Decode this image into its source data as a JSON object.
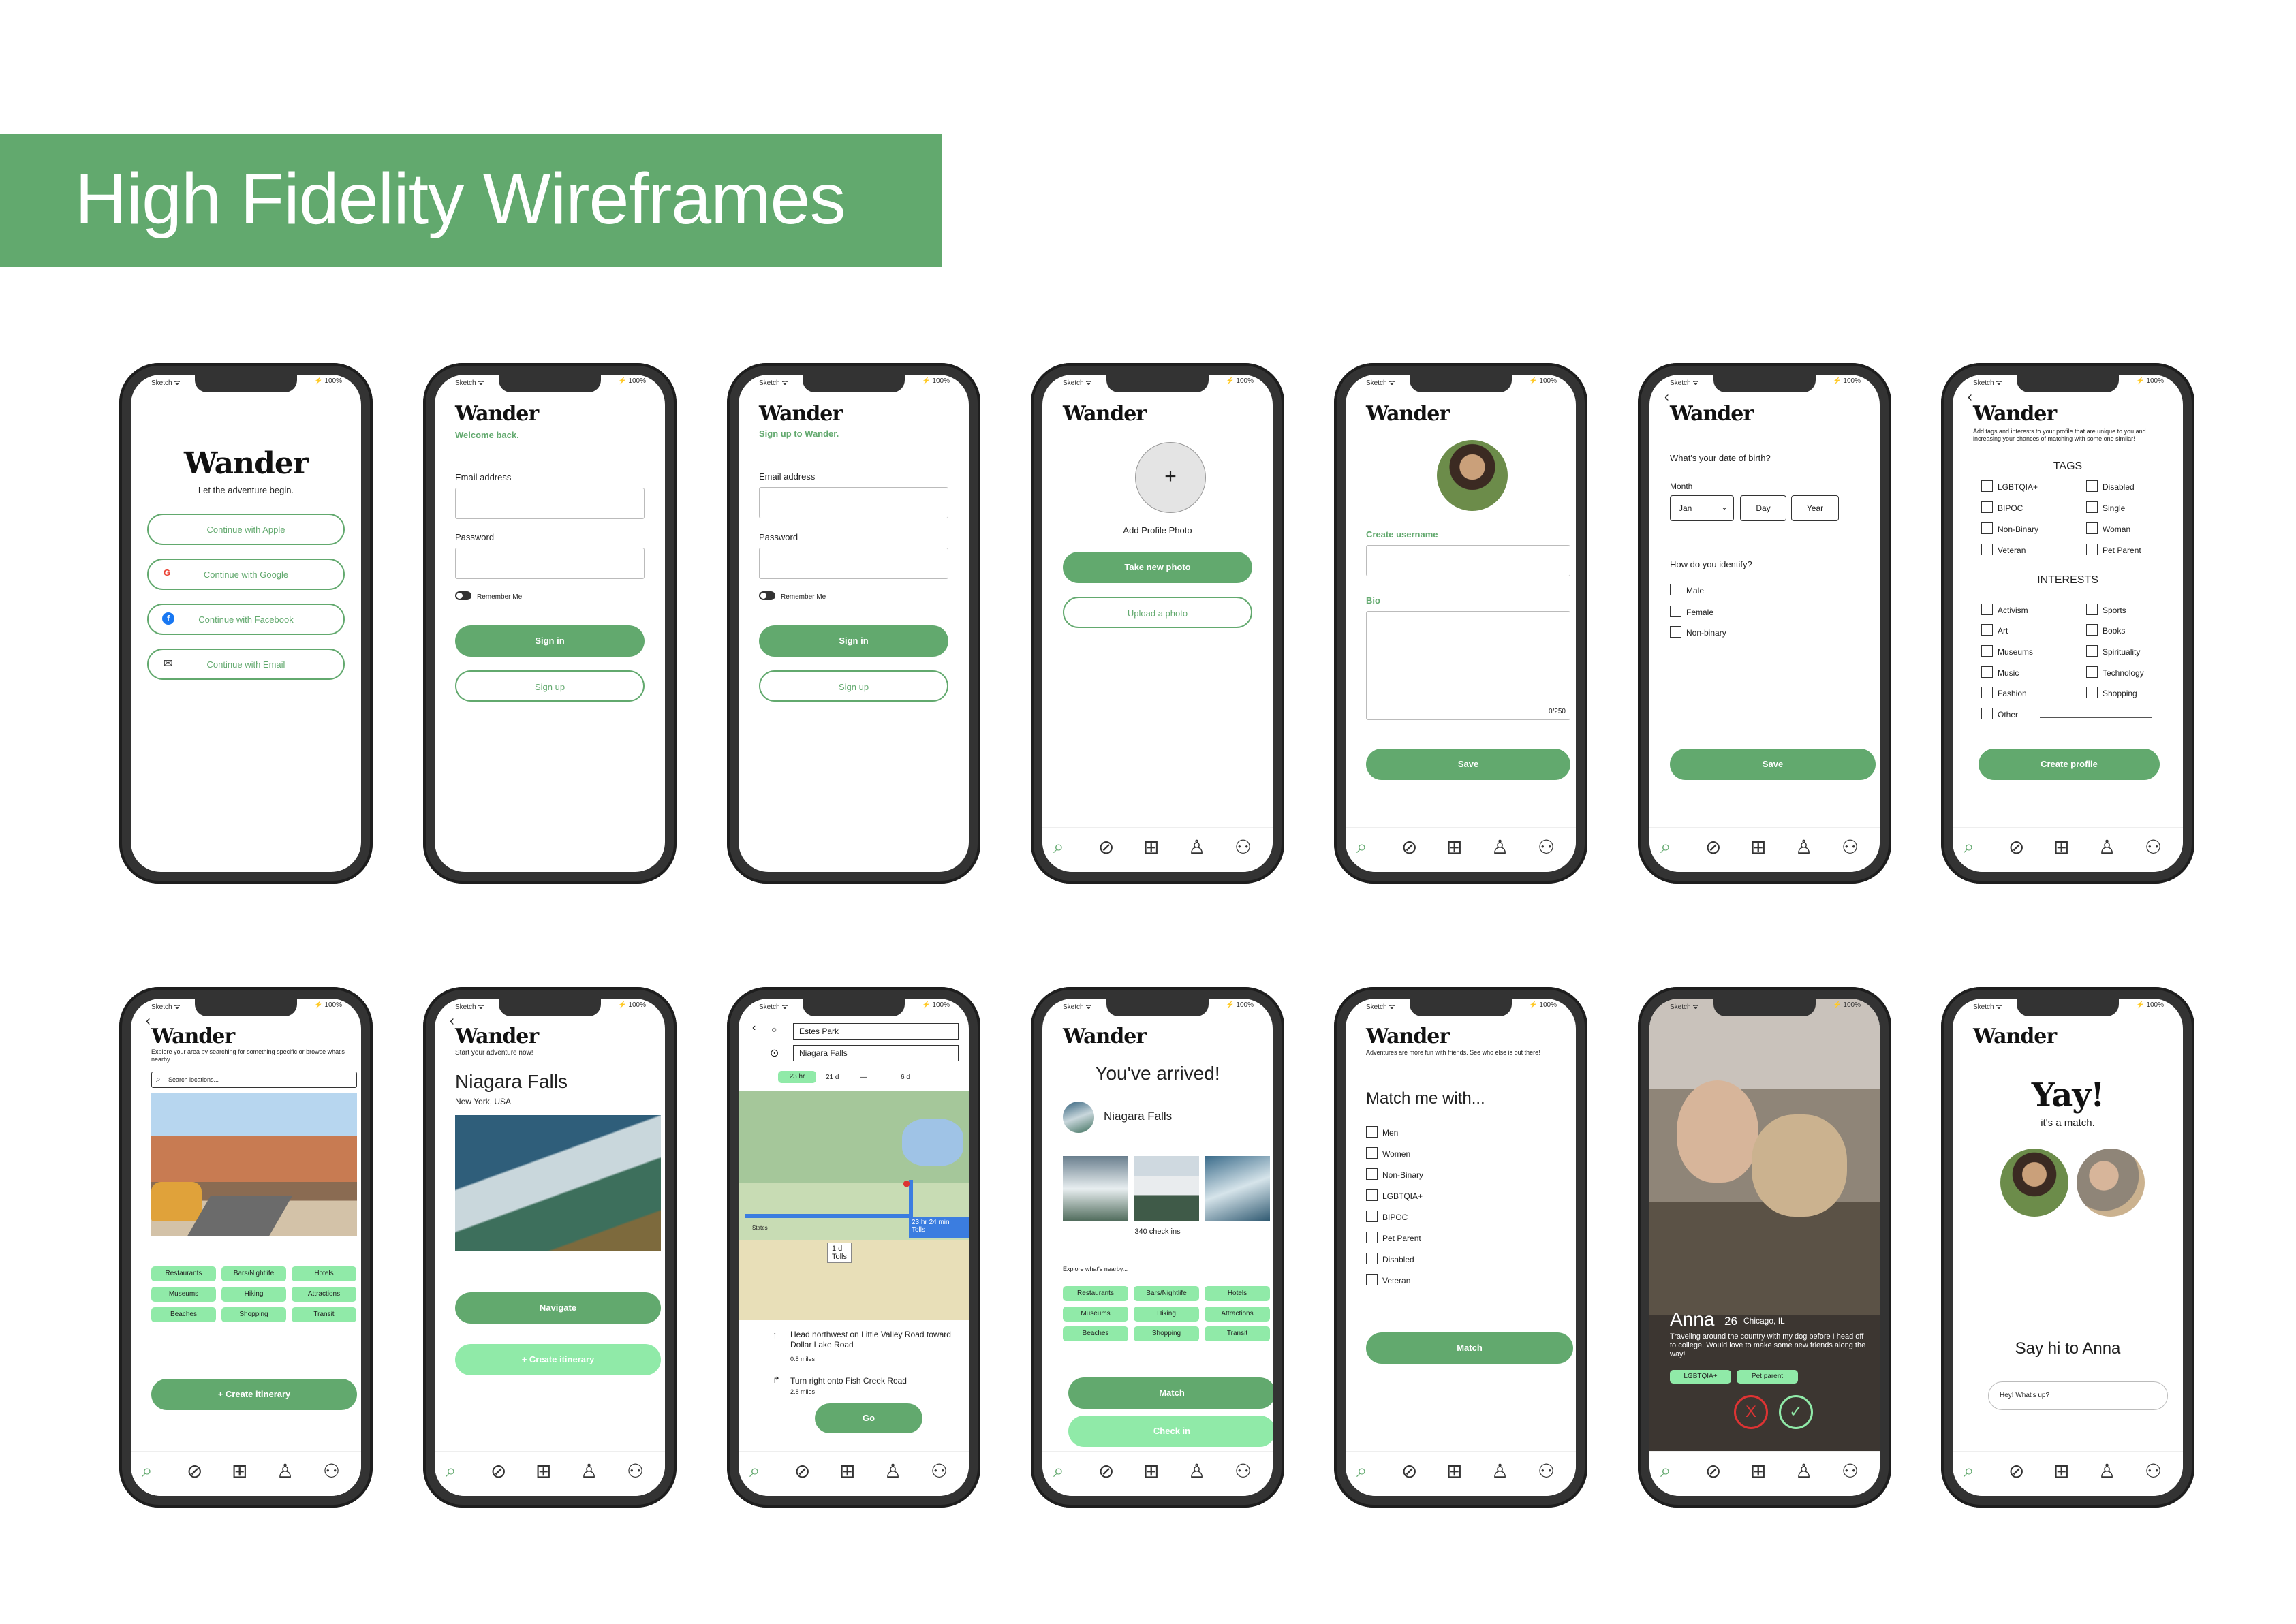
{
  "banner": {
    "title": "High Fidelity Wireframes"
  },
  "status": {
    "left": "Sketch ᯤ",
    "right": "⚡ 100%"
  },
  "brand": "Wander",
  "nav_icons": [
    "search-icon",
    "compass-icon",
    "add-file-icon",
    "user-icon",
    "match-users-icon"
  ],
  "s1": {
    "tagline": "Let the adventure begin.",
    "apple": "Continue with Apple",
    "google": "Continue with Google",
    "facebook": "Continue with Facebook",
    "email": "Continue with Email"
  },
  "s2": {
    "subtitle": "Welcome back.",
    "email_label": "Email address",
    "password_label": "Password",
    "remember": "Remember Me",
    "primary": "Sign in",
    "secondary": "Sign up"
  },
  "s3": {
    "subtitle": "Sign up to Wander.",
    "email_label": "Email address",
    "password_label": "Password",
    "remember": "Remember Me",
    "primary": "Sign in",
    "secondary": "Sign up"
  },
  "s4": {
    "plus": "+",
    "add_photo": "Add Profile Photo",
    "take": "Take new photo",
    "upload": "Upload a photo"
  },
  "s5": {
    "username_label": "Create username",
    "bio_label": "Bio",
    "counter": "0/250",
    "save": "Save"
  },
  "s6": {
    "back": "‹",
    "dob_q": "What's your date of birth?",
    "month_label": "Month",
    "month": "Jan",
    "day": "Day",
    "year": "Year",
    "identify_q": "How do you identify?",
    "opts": [
      "Male",
      "Female",
      "Non-binary"
    ],
    "save": "Save"
  },
  "s7": {
    "back": "‹",
    "intro": "Add tags and interests to your profile that are unique to you and increasing your chances of matching with some one similar!",
    "tags_h": "TAGS",
    "tags_l": [
      "LGBTQIA+",
      "BIPOC",
      "Non-Binary",
      "Veteran"
    ],
    "tags_r": [
      "Disabled",
      "Single",
      "Woman",
      "Pet Parent"
    ],
    "int_h": "INTERESTS",
    "int_l": [
      "Activism",
      "Art",
      "Museums",
      "Music",
      "Fashion",
      "Other"
    ],
    "int_r": [
      "Sports",
      "Books",
      "Spirituality",
      "Technology",
      "Shopping"
    ],
    "create": "Create profile"
  },
  "s8": {
    "back": "‹",
    "intro": "Explore your area by searching for something specific or browse what's nearby.",
    "search": "Search locations...",
    "chips": [
      "Restaurants",
      "Bars/Nightlife",
      "Hotels",
      "Museums",
      "Hiking",
      "Attractions",
      "Beaches",
      "Shopping",
      "Transit"
    ],
    "create": "+ Create itinerary"
  },
  "s9": {
    "back": "‹",
    "subtitle": "Start your adventure now!",
    "place": "Niagara Falls",
    "location": "New York, USA",
    "navigate": "Navigate",
    "itinerary": "+ Create itinerary"
  },
  "s10": {
    "back": "‹",
    "from": "Estes Park",
    "to": "Niagara Falls",
    "modes": [
      "23 hr",
      "21 d",
      "—",
      "6 d"
    ],
    "route_time": "23 hr 24 min",
    "tolls": "Tolls",
    "states": "States",
    "alt_time": "1 d",
    "alt_tolls": "Tolls",
    "step1": "Head northwest on Little Valley Road toward Dollar Lake Road",
    "dist1": "0.8 miles",
    "step2": "Turn right onto Fish Creek Road",
    "dist2": "2.8 miles",
    "go": "Go"
  },
  "s11": {
    "arrived": "You've arrived!",
    "place": "Niagara Falls",
    "checkins": "340 check ins",
    "explore": "Explore what's nearby...",
    "chips": [
      "Restaurants",
      "Bars/Nightlife",
      "Hotels",
      "Museums",
      "Hiking",
      "Attractions",
      "Beaches",
      "Shopping",
      "Transit"
    ],
    "match": "Match",
    "checkin": "Check in"
  },
  "s12": {
    "intro": "Adventures are more fun with friends. See who else is out there!",
    "heading": "Match me with...",
    "opts": [
      "Men",
      "Women",
      "Non-Binary",
      "LGBTQIA+",
      "BIPOC",
      "Pet Parent",
      "Disabled",
      "Veteran"
    ],
    "match": "Match"
  },
  "s13": {
    "name": "Anna",
    "age": "26",
    "city": "Chicago, IL",
    "bio": "Traveling around the country with my dog before I head off to college. Would love to make some new friends along the way!",
    "tags": [
      "LGBTQIA+",
      "Pet parent"
    ],
    "reject": "X"
  },
  "s14": {
    "yay": "Yay!",
    "sub": "it's a match.",
    "say": "Say hi to Anna",
    "placeholder": "Hey! What's up?"
  }
}
